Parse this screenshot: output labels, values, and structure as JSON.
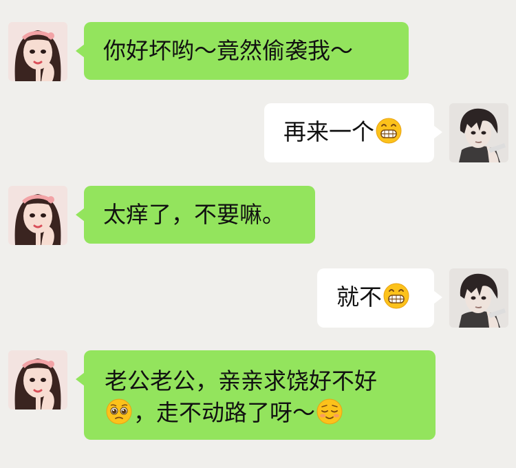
{
  "conversation": {
    "messages": [
      {
        "sender": "her",
        "text": "你好坏哟～竟然偷袭我～",
        "avatar": "girl-avatar"
      },
      {
        "sender": "him",
        "text": "再来一个",
        "emoji": "grinning-face-emoji",
        "avatar": "boy-avatar"
      },
      {
        "sender": "her",
        "text": "太痒了，不要嘛。",
        "avatar": "girl-avatar"
      },
      {
        "sender": "him",
        "text": "就不",
        "emoji": "grinning-face-emoji",
        "avatar": "boy-avatar"
      },
      {
        "sender": "her",
        "line1": "老公老公，亲亲求饶好不好",
        "line2_a": "，走不动路了呀～",
        "emoji_a": "pleading-face-emoji",
        "emoji_b": "relieved-face-emoji",
        "avatar": "girl-avatar"
      }
    ]
  },
  "colors": {
    "background": "#f0efec",
    "incoming_bubble": "#93e45d",
    "outgoing_bubble": "#ffffff"
  }
}
